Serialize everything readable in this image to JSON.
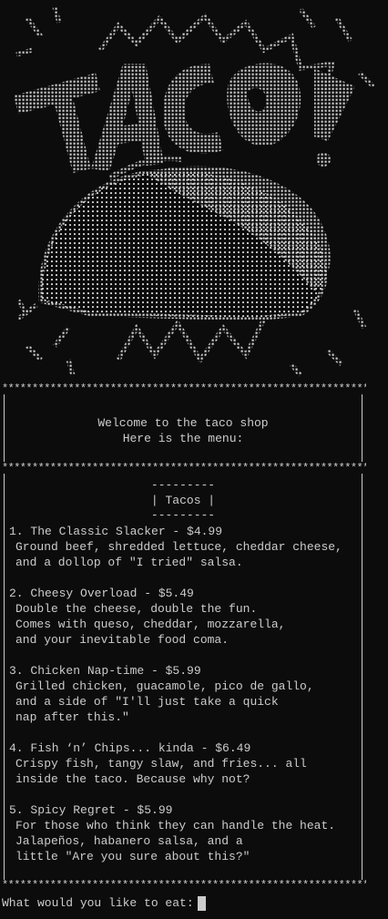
{
  "art": {
    "icon": "taco-ascii-art",
    "logo_text": "TACO"
  },
  "separator": "*****************************************************************",
  "welcome": {
    "line1": "Welcome to the taco shop",
    "line2": "Here is the menu:"
  },
  "menu": {
    "header_rule": "---------",
    "header": "| Tacos |",
    "items": [
      {
        "title": "1. The Classic Slacker - $4.99",
        "desc": [
          "Ground beef, shredded lettuce, cheddar cheese,",
          "and a dollop of \"I tried\" salsa."
        ]
      },
      {
        "title": "2. Cheesy Overload - $5.49",
        "desc": [
          "Double the cheese, double the fun.",
          "Comes with queso, cheddar, mozzarella,",
          "and your inevitable food coma."
        ]
      },
      {
        "title": "3. Chicken Nap-time - $5.99",
        "desc": [
          "Grilled chicken, guacamole, pico de gallo,",
          "and a side of \"I'll just take a quick",
          "nap after this.\""
        ]
      },
      {
        "title": "4. Fish ‘n’ Chips... kinda - $6.49",
        "desc": [
          "Crispy fish, tangy slaw, and fries... all",
          "inside the taco. Because why not?"
        ]
      },
      {
        "title": "5. Spicy Regret - $5.99",
        "desc": [
          "For those who think they can handle the heat.",
          "Jalapeños, habanero salsa, and a",
          "little \"Are you sure about this?\""
        ]
      }
    ]
  },
  "prompt": {
    "text": "What would you like to eat:",
    "value": ""
  },
  "colors": {
    "background": "#0c0c0c",
    "foreground": "#cccccc"
  }
}
